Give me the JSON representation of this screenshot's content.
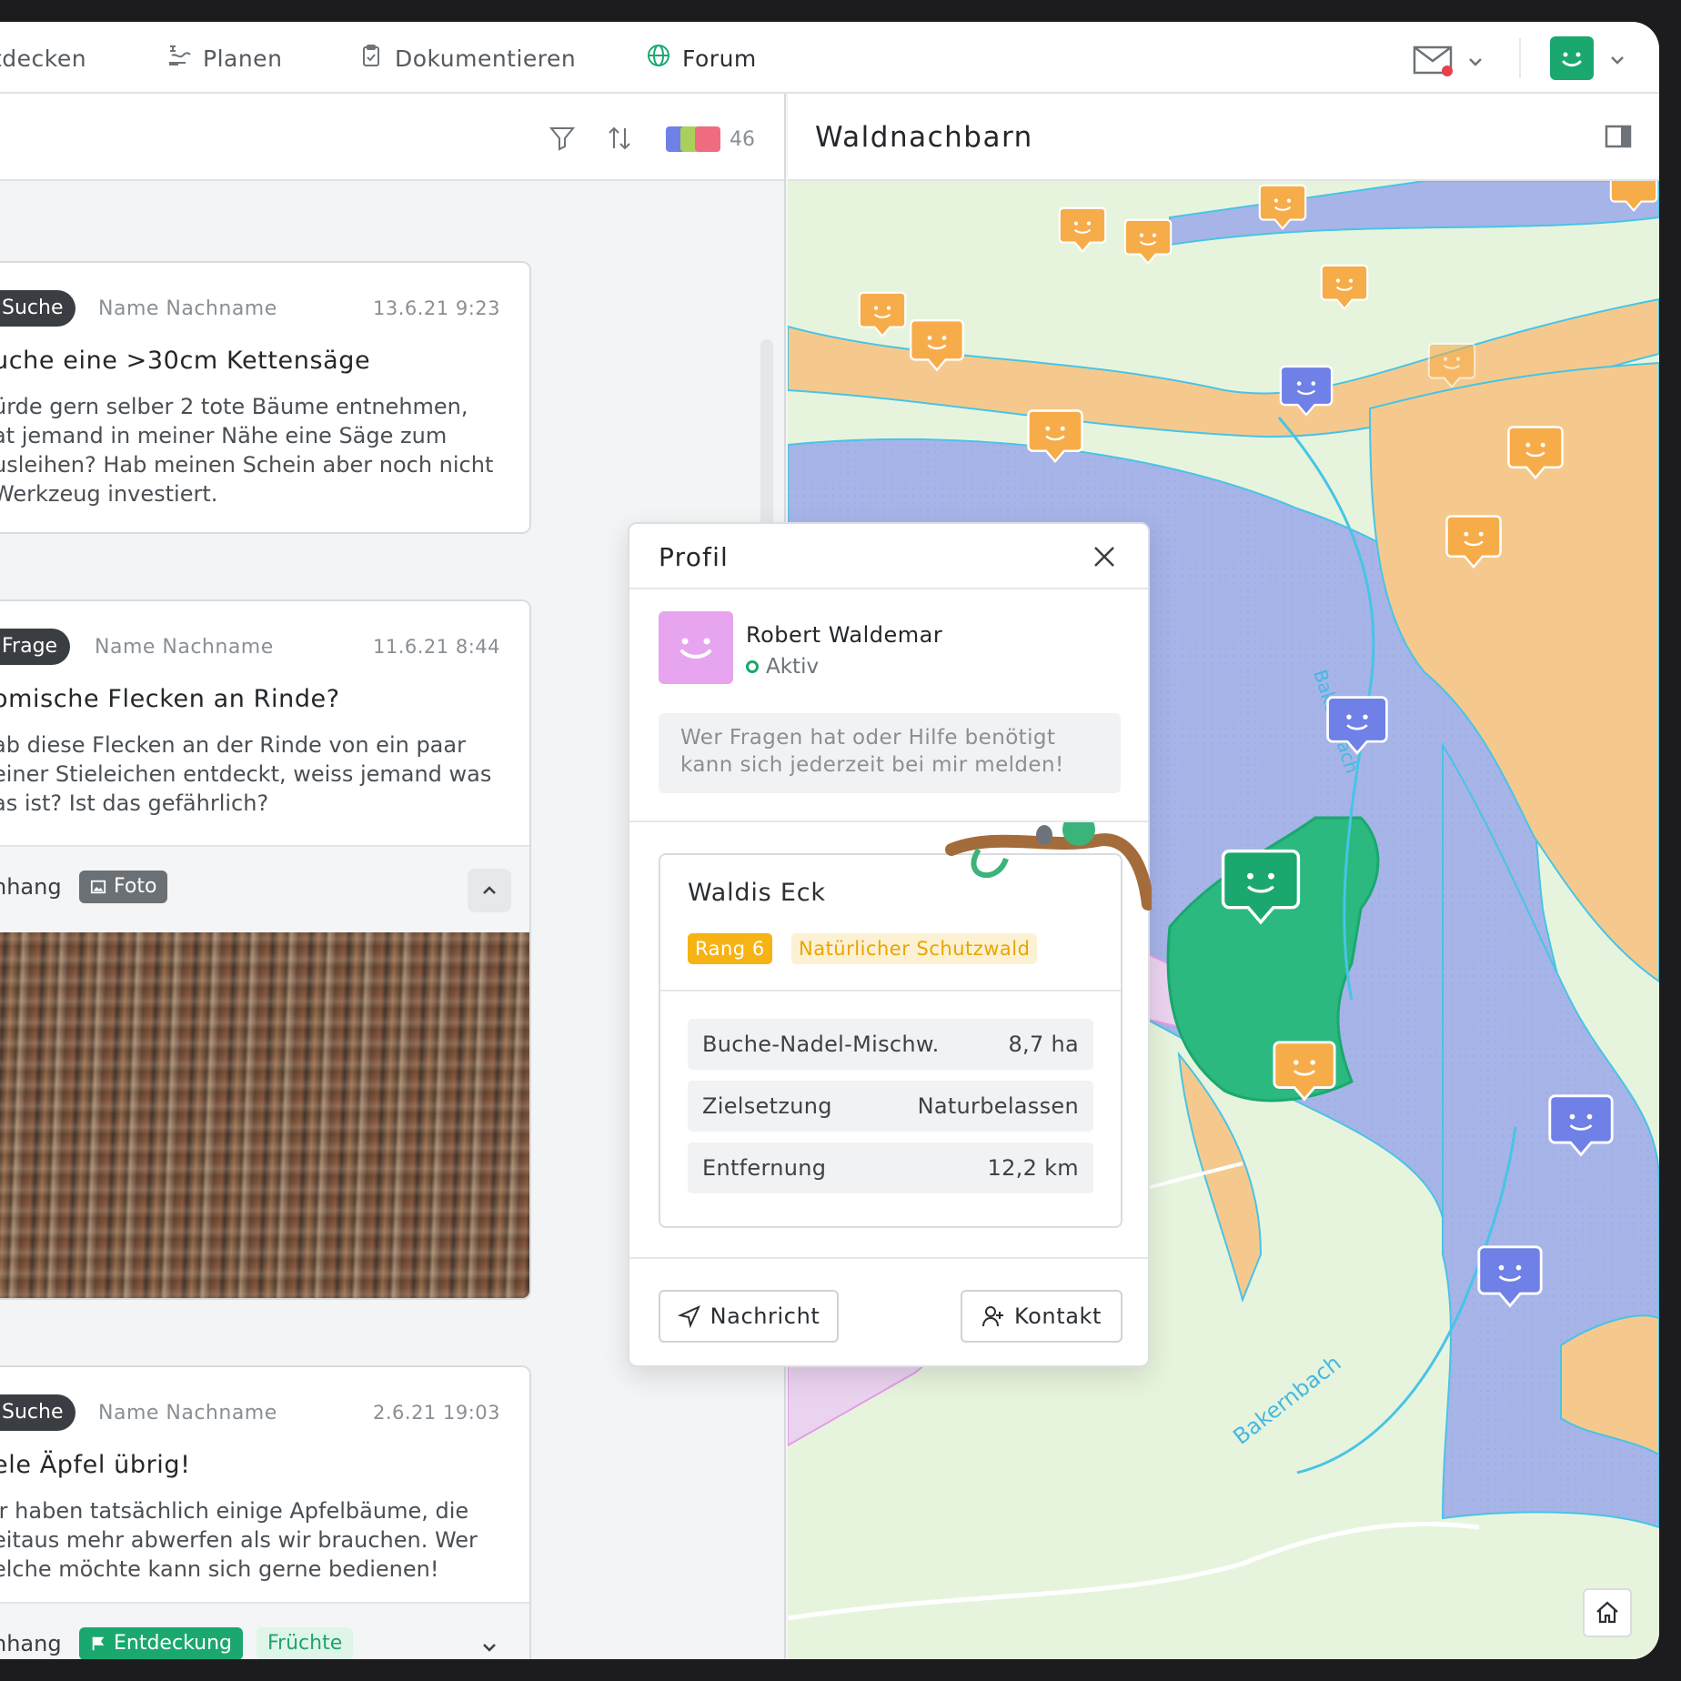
{
  "nav": {
    "items": [
      {
        "label": "tdecken",
        "icon": "discover-icon"
      },
      {
        "label": "Planen",
        "icon": "plan-icon"
      },
      {
        "label": "Dokumentieren",
        "icon": "clipboard-icon"
      },
      {
        "label": "Forum",
        "icon": "globe-icon"
      }
    ],
    "active": "Forum"
  },
  "list_toolbar": {
    "member_count": "46"
  },
  "posts": [
    {
      "tag": "Suche",
      "author": "Name Nachname",
      "date": "13.6.21  9:23",
      "title": "uche eine >30cm Kettensäge",
      "body": "ürde gern selber 2 tote Bäume entnehmen,\nat jemand in meiner Nähe eine Säge zum\nusleihen? Hab meinen Schein aber noch nicht\n Werkzeug investiert."
    },
    {
      "tag": "Frage",
      "author": "Name Nachname",
      "date": "11.6.21  8:44",
      "title": "omische Flecken an Rinde?",
      "body": "ab diese Flecken an der Rinde von ein paar\neiner Stieleichen entdeckt, weiss jemand was\nas ist? Ist das gefährlich?",
      "attachment_label": "nhang",
      "attachment_chip": "Foto"
    },
    {
      "tag": "Suche",
      "author": "Name Nachname",
      "date": "2.6.21  19:03",
      "title": "ele Äpfel übrig!",
      "body": "ir haben tatsächlich einige Apfelbäume, die\neitaus mehr abwerfen als wir brauchen. Wer\nelche möchte kann sich gerne bedienen!",
      "attachment_label": "nhang",
      "attachment_chips": [
        "Entdeckung",
        "Früchte"
      ]
    }
  ],
  "map": {
    "title": "Waldnachbarn",
    "stream_label": "Bakernbach",
    "colors": {
      "forest_orange": "#f5c98d",
      "forest_blue": "#a6b4e8",
      "forest_green": "#2bb97f",
      "pin_orange": "#f7ac4a",
      "pin_blue": "#6f80e6",
      "pin_pink": "#e59be9",
      "meadow": "#e7f4dd"
    }
  },
  "profile": {
    "header": "Profil",
    "name": "Robert Waldemar",
    "status": "Aktiv",
    "bio": "Wer Fragen hat oder Hilfe benötigt kann sich jederzeit bei mir melden!",
    "forest": {
      "name": "Waldis Eck",
      "rank": "Rang 6",
      "type": "Natürlicher Schutzwald",
      "rows": [
        {
          "key": "Buche-Nadel-Mischw.",
          "value": "8,7 ha"
        },
        {
          "key": "Zielsetzung",
          "value": "Naturbelassen"
        },
        {
          "key": "Entfernung",
          "value": "12,2 km"
        }
      ]
    },
    "message_button": "Nachricht",
    "contact_button": "Kontakt"
  }
}
